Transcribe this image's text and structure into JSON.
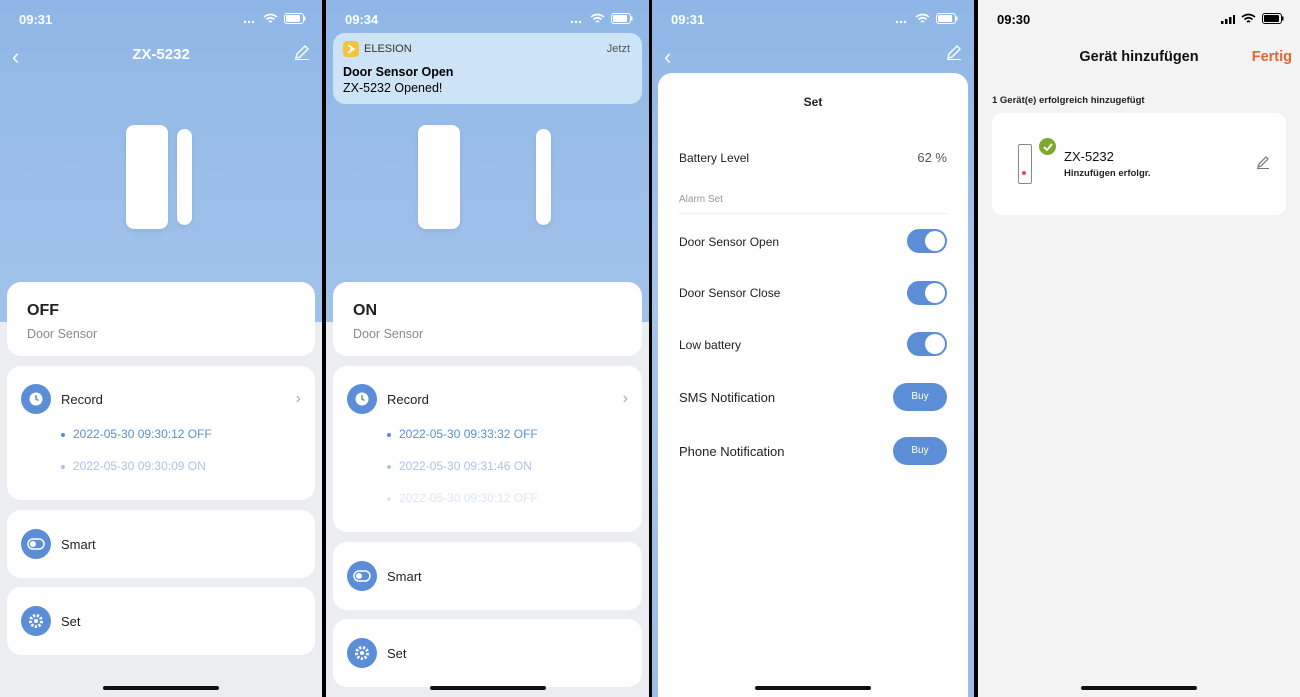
{
  "screen1": {
    "time": "09:31",
    "title": "ZX-5232",
    "state": "OFF",
    "device_type": "Door Sensor",
    "record_label": "Record",
    "records": [
      "2022-05-30 09:30:12 OFF",
      "2022-05-30 09:30:09 ON"
    ],
    "smart_label": "Smart",
    "set_label": "Set"
  },
  "screen2": {
    "time": "09:34",
    "notification": {
      "app": "ELESION",
      "when": "Jetzt",
      "title": "Door Sensor Open",
      "body": "ZX-5232 Opened!"
    },
    "state": "ON",
    "device_type": "Door Sensor",
    "record_label": "Record",
    "records": [
      "2022-05-30 09:33:32 OFF",
      "2022-05-30 09:31:46 ON",
      "2022-05-30 09:30:12 OFF"
    ],
    "smart_label": "Smart",
    "set_label": "Set"
  },
  "screen3": {
    "time": "09:31",
    "title": "Set",
    "battery_label": "Battery Level",
    "battery_value": "62 %",
    "alarm_section": "Alarm Set",
    "toggles": [
      {
        "label": "Door Sensor Open",
        "on": true
      },
      {
        "label": "Door Sensor Close",
        "on": true
      },
      {
        "label": "Low battery",
        "on": true
      }
    ],
    "sms_label": "SMS Notification",
    "phone_label": "Phone Notification",
    "buy_label": "Buy"
  },
  "screen4": {
    "time": "09:30",
    "title": "Gerät hinzufügen",
    "done": "Fertig",
    "success_count": "1 Gerät(e) erfolgreich hinzugefügt",
    "device_name": "ZX-5232",
    "device_status": "Hinzufügen erfolgr."
  },
  "colors": {
    "accent": "#5b8ed6",
    "done": "#e8642c",
    "check": "#7fa830"
  }
}
